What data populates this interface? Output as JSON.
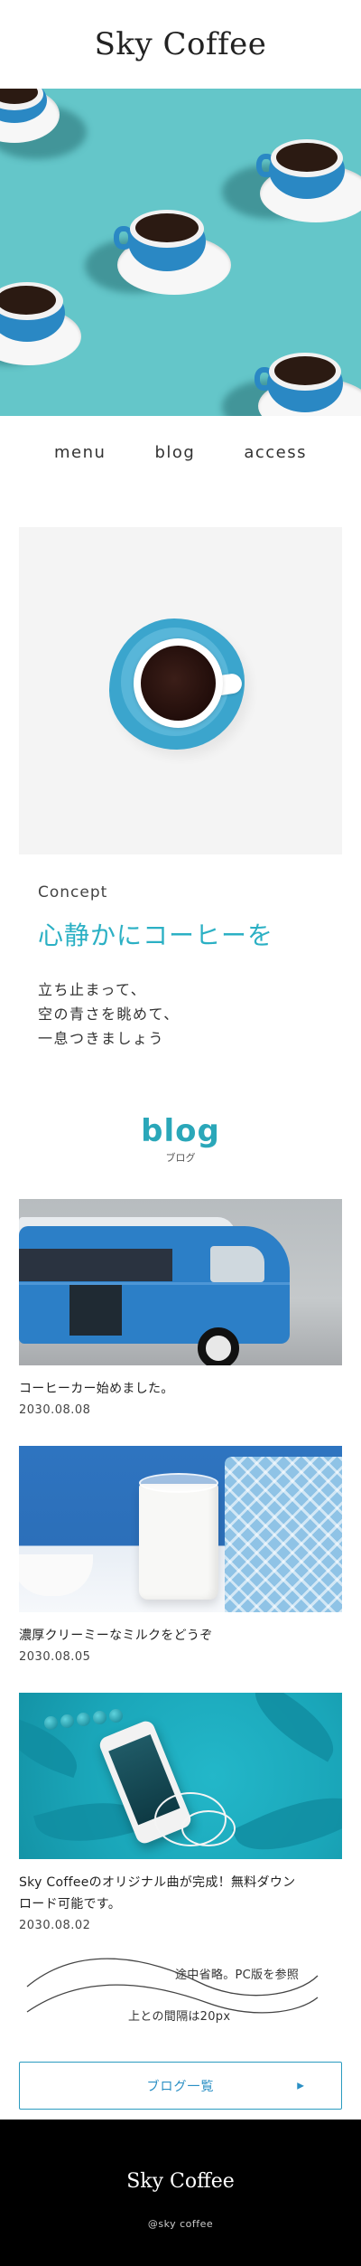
{
  "header": {
    "logo": "Sky Coffee"
  },
  "nav": {
    "items": [
      "menu",
      "blog",
      "access"
    ]
  },
  "concept": {
    "label": "Concept",
    "title": "心静かにコーヒーを",
    "lines": [
      "立ち止まって、",
      "空の青さを眺めて、",
      "一息つきましょう"
    ]
  },
  "blog": {
    "title": "blog",
    "subtitle": "ブログ",
    "posts": [
      {
        "title": "コーヒーカー始めました。",
        "date": "2030.08.08"
      },
      {
        "title": "濃厚クリーミーなミルクをどうぞ",
        "date": "2030.08.05"
      },
      {
        "title": "Sky Coffeeのオリジナル曲が完成！無料ダウンロード可能です。",
        "title_line1": "Sky Coffeeのオリジナル曲が完成！無料ダウン",
        "title_line2": "ロード可能です。",
        "date": "2030.08.02"
      }
    ],
    "note_line1": "途中省略。PC版を参照",
    "note_line2": "上との間隔は20px",
    "button_label": "ブログ一覧",
    "button_arrow": "▶"
  },
  "footer": {
    "logo": "Sky Coffee",
    "copyright": "@sky coffee"
  },
  "colors": {
    "accent": "#2aa7b9",
    "hero_bg": "#64c6c9",
    "footer_bg": "#000000"
  }
}
